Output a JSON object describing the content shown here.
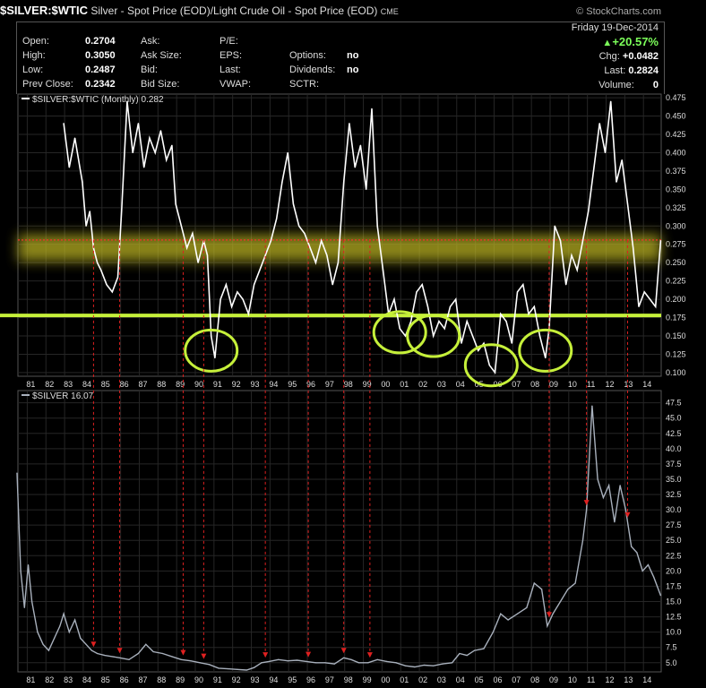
{
  "header": {
    "symbol": "$SILVER:$WTIC",
    "description": "Silver - Spot Price (EOD)/Light Crude Oil - Spot Price (EOD)",
    "exchange": "CME",
    "watermark": "© StockCharts.com",
    "date": "Friday 19-Dec-2014",
    "pct_change": "+20.57%",
    "chg_label": "Chg:",
    "chg_value": "+0.0482",
    "last_label": "Last:",
    "last_value": "0.2824",
    "volume_label": "Volume:",
    "volume_value": "0"
  },
  "stats": {
    "open_label": "Open:",
    "open_value": "0.2704",
    "high_label": "High:",
    "high_value": "0.3050",
    "low_label": "Low:",
    "low_value": "0.2487",
    "prevclose_label": "Prev Close:",
    "prevclose_value": "0.2342",
    "ask_label": "Ask:",
    "asksize_label": "Ask Size:",
    "bid_label": "Bid:",
    "bidsize_label": "Bid Size:",
    "pe_label": "P/E:",
    "eps_label": "EPS:",
    "last_label": "Last:",
    "vwap_label": "VWAP:",
    "options_label": "Options:",
    "options_value": "no",
    "dividends_label": "Dividends:",
    "dividends_value": "no",
    "sctr_label": "SCTR:"
  },
  "colors": {
    "ratio_line": "#ffffff",
    "silver_line": "#a8b0bc",
    "support": "#c6f03a",
    "resistance": "#e03a2a",
    "band": "#b8b020",
    "arrows": "#e02020"
  },
  "chart_data": [
    {
      "type": "line",
      "legend": "$SILVER:$WTIC (Monthly) 0.282",
      "x_ticks": [
        "81",
        "82",
        "83",
        "84",
        "85",
        "86",
        "87",
        "88",
        "89",
        "90",
        "91",
        "92",
        "93",
        "94",
        "95",
        "96",
        "97",
        "98",
        "99",
        "00",
        "01",
        "02",
        "03",
        "04",
        "05",
        "06",
        "07",
        "08",
        "09",
        "10",
        "11",
        "12",
        "13",
        "14"
      ],
      "y_ticks": [
        "0.475",
        "0.450",
        "0.425",
        "0.400",
        "0.375",
        "0.350",
        "0.325",
        "0.300",
        "0.275",
        "0.250",
        "0.225",
        "0.200",
        "0.175",
        "0.150",
        "0.125",
        "0.100"
      ],
      "ylim": [
        0.095,
        0.48
      ],
      "support_level": 0.178,
      "resistance_level": 0.281,
      "x": [
        1983.0,
        1983.3,
        1983.6,
        1984.0,
        1984.2,
        1984.4,
        1984.6,
        1984.8,
        1985.0,
        1985.3,
        1985.6,
        1985.9,
        1986.1,
        1986.4,
        1986.7,
        1987.0,
        1987.3,
        1987.6,
        1987.9,
        1988.2,
        1988.5,
        1988.8,
        1989.0,
        1989.3,
        1989.6,
        1989.9,
        1990.2,
        1990.5,
        1990.7,
        1990.9,
        1991.1,
        1991.4,
        1991.7,
        1992.0,
        1992.3,
        1992.6,
        1992.9,
        1993.2,
        1993.5,
        1993.8,
        1994.1,
        1994.4,
        1994.7,
        1995.0,
        1995.3,
        1995.6,
        1995.9,
        1996.2,
        1996.5,
        1996.8,
        1997.1,
        1997.4,
        1997.7,
        1998.0,
        1998.3,
        1998.6,
        1998.9,
        1999.2,
        1999.5,
        1999.8,
        2000.1,
        2000.4,
        2000.7,
        2001.0,
        2001.3,
        2001.6,
        2001.9,
        2002.2,
        2002.5,
        2002.8,
        2003.1,
        2003.4,
        2003.7,
        2004.0,
        2004.3,
        2004.6,
        2004.9,
        2005.2,
        2005.5,
        2005.8,
        2006.1,
        2006.4,
        2006.7,
        2007.0,
        2007.3,
        2007.6,
        2007.9,
        2008.2,
        2008.5,
        2008.8,
        2009.0,
        2009.3,
        2009.6,
        2009.9,
        2010.2,
        2010.5,
        2010.8,
        2011.1,
        2011.4,
        2011.7,
        2012.0,
        2012.3,
        2012.6,
        2012.9,
        2013.2,
        2013.5,
        2013.8,
        2014.1,
        2014.4,
        2014.7,
        2014.97
      ],
      "values": [
        0.44,
        0.38,
        0.42,
        0.36,
        0.3,
        0.32,
        0.27,
        0.25,
        0.24,
        0.22,
        0.21,
        0.23,
        0.32,
        0.47,
        0.4,
        0.44,
        0.38,
        0.42,
        0.4,
        0.43,
        0.39,
        0.41,
        0.33,
        0.3,
        0.27,
        0.29,
        0.25,
        0.28,
        0.26,
        0.15,
        0.12,
        0.2,
        0.22,
        0.19,
        0.21,
        0.2,
        0.18,
        0.22,
        0.24,
        0.26,
        0.28,
        0.31,
        0.36,
        0.4,
        0.33,
        0.3,
        0.29,
        0.27,
        0.25,
        0.28,
        0.26,
        0.22,
        0.25,
        0.36,
        0.44,
        0.38,
        0.41,
        0.35,
        0.46,
        0.3,
        0.24,
        0.18,
        0.2,
        0.16,
        0.15,
        0.17,
        0.21,
        0.22,
        0.19,
        0.15,
        0.17,
        0.16,
        0.19,
        0.2,
        0.14,
        0.17,
        0.15,
        0.13,
        0.14,
        0.11,
        0.1,
        0.18,
        0.17,
        0.14,
        0.21,
        0.22,
        0.18,
        0.19,
        0.15,
        0.12,
        0.16,
        0.3,
        0.28,
        0.22,
        0.26,
        0.24,
        0.28,
        0.32,
        0.38,
        0.44,
        0.4,
        0.47,
        0.36,
        0.39,
        0.33,
        0.27,
        0.19,
        0.21,
        0.2,
        0.19,
        0.28
      ]
    },
    {
      "type": "line",
      "legend": "$SILVER 16.07",
      "x_ticks": [
        "81",
        "82",
        "83",
        "84",
        "85",
        "86",
        "87",
        "88",
        "89",
        "90",
        "91",
        "92",
        "93",
        "94",
        "95",
        "96",
        "97",
        "98",
        "99",
        "00",
        "01",
        "02",
        "03",
        "04",
        "05",
        "06",
        "07",
        "08",
        "09",
        "10",
        "11",
        "12",
        "13",
        "14"
      ],
      "y_ticks": [
        "47.5",
        "45.0",
        "42.5",
        "40.0",
        "37.5",
        "35.0",
        "32.5",
        "30.0",
        "27.5",
        "25.0",
        "22.5",
        "20.0",
        "17.5",
        "15.0",
        "12.5",
        "10.0",
        "7.5",
        "5.0"
      ],
      "ylim": [
        3.5,
        49.5
      ],
      "x": [
        1980.5,
        1980.7,
        1980.9,
        1981.1,
        1981.3,
        1981.6,
        1981.9,
        1982.2,
        1982.5,
        1982.8,
        1983.0,
        1983.3,
        1983.6,
        1983.9,
        1984.2,
        1984.5,
        1984.8,
        1985.2,
        1985.6,
        1986.0,
        1986.5,
        1987.0,
        1987.4,
        1987.8,
        1988.3,
        1988.8,
        1989.3,
        1989.8,
        1990.3,
        1990.8,
        1991.3,
        1991.8,
        1992.3,
        1992.8,
        1993.2,
        1993.6,
        1994.0,
        1994.5,
        1995.0,
        1995.5,
        1996.0,
        1996.5,
        1997.0,
        1997.5,
        1998.0,
        1998.4,
        1998.8,
        1999.3,
        1999.8,
        2000.3,
        2000.8,
        2001.3,
        2001.8,
        2002.3,
        2002.8,
        2003.3,
        2003.8,
        2004.2,
        2004.6,
        2005.0,
        2005.5,
        2006.0,
        2006.4,
        2006.8,
        2007.3,
        2007.8,
        2008.2,
        2008.6,
        2008.9,
        2009.2,
        2009.6,
        2010.0,
        2010.4,
        2010.8,
        2011.0,
        2011.3,
        2011.6,
        2011.9,
        2012.2,
        2012.5,
        2012.8,
        2013.1,
        2013.4,
        2013.7,
        2014.0,
        2014.3,
        2014.6,
        2014.97
      ],
      "values": [
        36,
        20,
        14,
        21,
        15,
        10,
        8,
        7,
        9,
        11,
        13,
        10,
        12,
        9,
        8,
        7,
        6.5,
        6.2,
        6,
        5.8,
        5.5,
        6.5,
        8,
        6.8,
        6.5,
        6,
        5.5,
        5.3,
        5,
        4.7,
        4.1,
        4.0,
        3.9,
        3.8,
        4.2,
        5.0,
        5.2,
        5.5,
        5.3,
        5.4,
        5.2,
        5.0,
        5.0,
        4.8,
        5.8,
        5.5,
        5.0,
        5.0,
        5.5,
        5.2,
        5.0,
        4.5,
        4.3,
        4.6,
        4.5,
        4.8,
        5.0,
        6.5,
        6.2,
        7.0,
        7.3,
        10,
        13,
        12,
        13,
        14,
        18,
        17,
        11,
        13,
        15,
        17,
        18,
        25,
        30,
        47,
        35,
        32,
        34,
        28,
        34,
        30,
        24,
        23,
        20,
        21,
        19,
        16
      ]
    }
  ]
}
